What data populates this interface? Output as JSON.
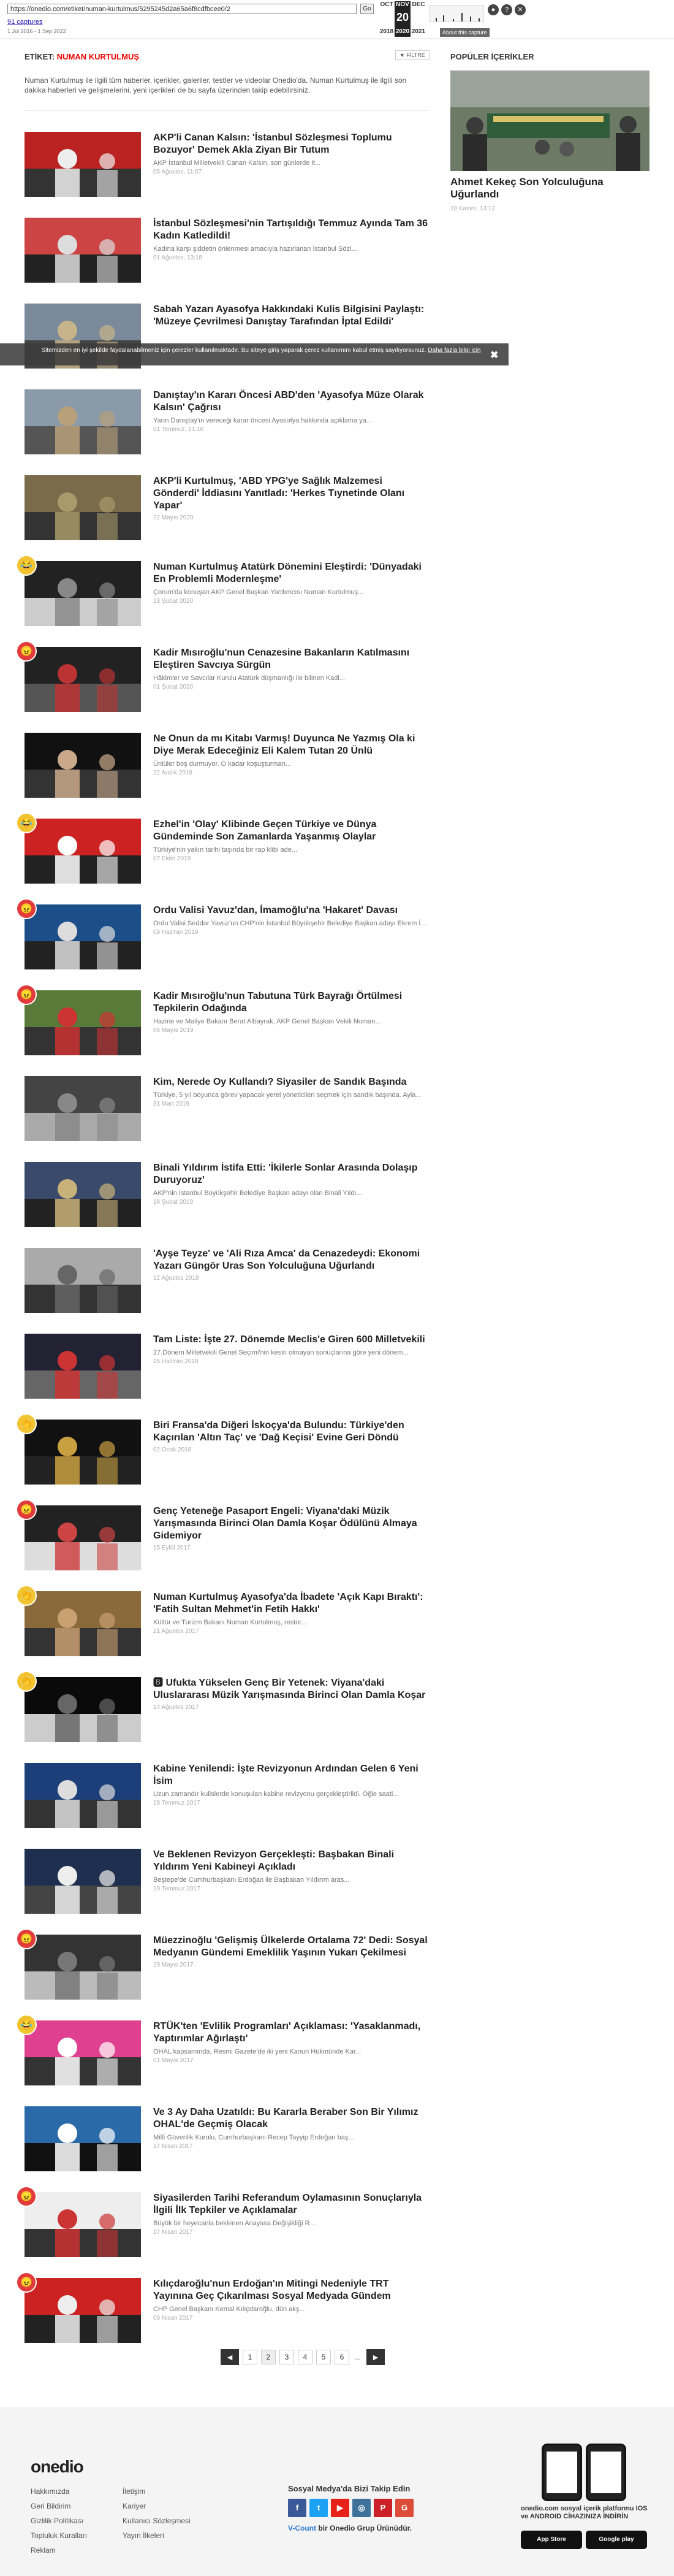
{
  "wayback": {
    "url": "https://onedio.com/etiket/numan-kurtulmus/5295245d2a65a6f8cdfbcee0/2",
    "go_label": "Go",
    "captures_label": "91 captures",
    "capture_range": "1 Jul 2016 - 1 Sep 2022",
    "months": [
      "OCT",
      "NOV",
      "DEC"
    ],
    "day": "20",
    "years": [
      "2018",
      "2020",
      "2021"
    ],
    "about_label": "About this capture"
  },
  "tag": {
    "prefix": "ETİKET:",
    "name": "NUMAN KURTULMUŞ",
    "filter_label": "▼ FİLTRE",
    "intro": "Numan Kurtulmuş ile ilgili tüm haberler, içerikler, galeriler, testler ve videolar Onedio'da. Numan Kurtulmuş ile ilgili son dakika haberleri ve gelişmelerini, yeni içerikleri de bu sayfa üzerinden takip edebilirsiniz."
  },
  "cookie": {
    "text": "Sitemizden en iyi şekilde faydalanabilmeniz için çerezler kullanılmaktadır. Bu siteye giriş yaparak çerez kullanımını kabul etmiş sayılıyorsunuz.",
    "link": "Daha fazla bilgi için",
    "close": "✖"
  },
  "items": [
    {
      "title": "AKP'li Canan Kalsın: 'İstanbul Sözleşmesi Toplumu Bozuyor' Demek Akla Ziyan Bir Tutum",
      "desc": "AKP İstanbul Milletvekili Canan Kalsın, son günlerde it...",
      "date": "05 Ağustos, 11:07",
      "badge": ""
    },
    {
      "title": "İstanbul Sözleşmesi'nin Tartışıldığı Temmuz Ayında Tam 36 Kadın Katledildi!",
      "desc": "Kadına karşı şiddetin önlenmesi amacıyla hazırlanan İstanbul Sözl...",
      "date": "01 Ağustos, 13:18",
      "badge": ""
    },
    {
      "title": "Sabah Yazarı Ayasofya Hakkındaki Kulis Bilgisini Paylaştı: 'Müzeye Çevrilmesi Danıştay Tarafından İptal Edildi'",
      "desc": "",
      "date": "",
      "badge": ""
    },
    {
      "title": "Danıştay'ın Kararı Öncesi ABD'den 'Ayasofya Müze Olarak Kalsın' Çağrısı",
      "desc": "Yarın Danıştay'ın vereceği karar öncesi Ayasofya hakkında açıklama ya...",
      "date": "01 Temmuz, 21:16",
      "badge": ""
    },
    {
      "title": "AKP'li Kurtulmuş, 'ABD YPG'ye Sağlık Malzemesi Gönderdi' İddiasını Yanıtladı: 'Herkes Tıynetinde Olanı Yapar'",
      "desc": "",
      "date": "22 Mayıs 2020",
      "badge": ""
    },
    {
      "title": "Numan Kurtulmuş Atatürk Dönemini Eleştirdi: 'Dünyadaki En Problemli Modernleşme'",
      "desc": "Çorum'da konuşan AKP Genel Başkan Yardımcısı Numan Kurtulmuş...",
      "date": "13 Şubat 2020",
      "badge": "laugh"
    },
    {
      "title": "Kadir Mısıroğlu'nun Cenazesine Bakanların Katılmasını Eleştiren Savcıya Sürgün",
      "desc": "Hâkimler ve Savcılar Kurulu Atatürk düşmanlığı ile bilinen Kadi...",
      "date": "01 Şubat 2020",
      "badge": "angry"
    },
    {
      "title": "Ne Onun da mı Kitabı Varmış! Duyunca Ne Yazmış Ola ki Diye Merak Edeceğiniz Eli Kalem Tutan 20 Ünlü",
      "desc": "Ünlüler boş durmuyor. O kadar koşuşturman...",
      "date": "22 Aralık 2019",
      "badge": ""
    },
    {
      "title": "Ezhel'in 'Olay' Klibinde Geçen Türkiye ve Dünya Gündeminde Son Zamanlarda Yaşanmış Olaylar",
      "desc": "Türkiye'nin yakın tarihi taşında bir rap klibi ade...",
      "date": "07 Ekim 2019",
      "badge": "laugh"
    },
    {
      "title": "Ordu Valisi Yavuz'dan, İmamoğlu'na 'Hakaret' Davası",
      "desc": "Ordu Valisi Seddar Yavuz'un CHP'nin İstanbul Büyükşehir Belediye Başkan adayı Ekrem İmamo...",
      "date": "09 Haziran 2019",
      "badge": "angry"
    },
    {
      "title": "Kadir Mısıroğlu'nun Tabutuna Türk Bayrağı Örtülmesi Tepkilerin Odağında",
      "desc": "Hazine ve Maliye Bakanı Berat Albayrak, AKP Genel Başkan Vekili Numan...",
      "date": "06 Mayıs 2019",
      "badge": "angry"
    },
    {
      "title": "Kim, Nerede Oy Kullandı? Siyasiler de Sandık Başında",
      "desc": "Türkiye, 5 yıl boyunca görev yapacak yerel yöneticileri seçmek için sandık başında. Ayla...",
      "date": "31 Mart 2019",
      "badge": ""
    },
    {
      "title": "Binali Yıldırım İstifa Etti: 'İkilerle Sonlar Arasında Dolaşıp Duruyoruz'",
      "desc": "AKP'nin İstanbul Büyükşehir Belediye Başkan adayı olan Binali Yıldı...",
      "date": "18 Şubat 2019",
      "badge": ""
    },
    {
      "title": "'Ayşe Teyze' ve 'Ali Rıza Amca' da Cenazedeydi: Ekonomi Yazarı Güngör Uras Son Yolculuğuna Uğurlandı",
      "desc": "",
      "date": "12 Ağustos 2018",
      "badge": ""
    },
    {
      "title": "Tam Liste: İşte 27. Dönemde Meclis'e Giren 600 Milletvekili",
      "desc": "27.Dönem Milletvekili Genel Seçimi'nin kesin olmayan sonuçlarına göre yeni dönem...",
      "date": "25 Haziran 2018",
      "badge": ""
    },
    {
      "title": "Biri Fransa'da Diğeri İskoçya'da Bulundu: Türkiye'den Kaçırılan 'Altın Taç' ve 'Dağ Keçisi' Evine Geri Döndü",
      "desc": "",
      "date": "02 Ocak 2018",
      "badge": "clap"
    },
    {
      "title": "Genç Yeteneğe Pasaport Engeli: Viyana'daki Müzik Yarışmasında Birinci Olan Damla Koşar Ödülünü Almaya Gidemiyor",
      "desc": "",
      "date": "15 Eylül 2017",
      "badge": "angry"
    },
    {
      "title": "Numan Kurtulmuş Ayasofya'da İbadete 'Açık Kapı Bıraktı': 'Fatih Sultan Mehmet'in Fetih Hakkı'",
      "desc": "Kültür ve Turizm Bakanı Numan Kurtulmuş, restor...",
      "date": "21 Ağustos 2017",
      "badge": "clap"
    },
    {
      "title": "🅱 Ufukta Yükselen Genç Bir Yetenek: Viyana'daki Uluslararası Müzik Yarışmasında Birinci Olan Damla Koşar",
      "desc": "",
      "date": "14 Ağustos 2017",
      "badge": "clap"
    },
    {
      "title": "Kabine Yenilendi: İşte Revizyonun Ardından Gelen 6 Yeni İsim",
      "desc": "Uzun zamandır kulislerde konuşulan kabine revizyonu gerçekleştirildi. Öğle saati...",
      "date": "19 Temmuz 2017",
      "badge": ""
    },
    {
      "title": "Ve Beklenen Revizyon Gerçekleşti: Başbakan Binali Yıldırım Yeni Kabineyi Açıkladı",
      "desc": "Beştepe'de Cumhurbaşkanı Erdoğan ile Başbakan Yıldırım aras...",
      "date": "19 Temmuz 2017",
      "badge": ""
    },
    {
      "title": "Müezzinoğlu 'Gelişmiş Ülkelerde Ortalama 72' Dedi: Sosyal Medyanın Gündemi Emeklilik Yaşının Yukarı Çekilmesi",
      "desc": "",
      "date": "29 Mayıs 2017",
      "badge": "angry"
    },
    {
      "title": "RTÜK'ten 'Evlilik Programları' Açıklaması: 'Yasaklanmadı, Yaptırımlar Ağırlaştı'",
      "desc": "OHAL kapsamında, Resmi Gazete'de iki yeni Kanun Hükmünde Kar...",
      "date": "01 Mayıs 2017",
      "badge": "laugh"
    },
    {
      "title": "Ve 3 Ay Daha Uzatıldı: Bu Kararla Beraber Son Bir Yılımız OHAL'de Geçmiş Olacak",
      "desc": "Millî Güvenlik Kurulu, Cumhurbaşkanı Recep Tayyip Erdoğan baş...",
      "date": "17 Nisan 2017",
      "badge": ""
    },
    {
      "title": "Siyasilerden Tarihi Referandum Oylamasının Sonuçlarıyla İlgili İlk Tepkiler ve Açıklamalar",
      "desc": "Büyük bir heyecanla beklenen Anayasa Değişikliği R...",
      "date": "17 Nisan 2017",
      "badge": "angry"
    },
    {
      "title": "Kılıçdaroğlu'nun Erdoğan'ın Mitingi Nedeniyle TRT Yayınına Geç Çıkarılması Sosyal Medyada Gündem",
      "desc": "CHP Genel Başkanı Kemal Kılıçdaroğlu, dün akş...",
      "date": "09 Nisan 2017",
      "badge": "angry"
    }
  ],
  "pager": {
    "prev": "◄",
    "pages": [
      "1",
      "2",
      "3",
      "4",
      "5",
      "6"
    ],
    "current": "2",
    "dots": "...",
    "next": "►"
  },
  "sidebar": {
    "heading": "POPÜLER İÇERİKLER",
    "title": "Ahmet Kekeç Son Yolculuğuna Uğurlandı",
    "date": "10 Kasım, 13:12"
  },
  "footer": {
    "logo": "onedio",
    "col1": [
      "Hakkımızda",
      "Geri Bildirim",
      "Gizlilik Politikası",
      "Topluluk Kuralları",
      "Reklam"
    ],
    "col2": [
      "İletişim",
      "Kariyer",
      "Kullanıcı Sözleşmesi",
      "Yayın İlkeleri"
    ],
    "social_heading": "Sosyal Medya'da Bizi Takip Edin",
    "social": [
      {
        "label": "f",
        "color": "#3b5998"
      },
      {
        "label": "t",
        "color": "#1da1f2"
      },
      {
        "label": "▶",
        "color": "#e62117"
      },
      {
        "label": "◎",
        "color": "#3f729b"
      },
      {
        "label": "P",
        "color": "#cb2027"
      },
      {
        "label": "G",
        "color": "#dd4b39"
      }
    ],
    "vcount_pre": "V-Count",
    "vcount_post": " bir Onedio Grup Ürünüdür.",
    "app_text": "onedio.com sosyal içerik platformu IOS ve ANDROID CİHAZINIZA İNDİRİN",
    "appstore": "App Store",
    "googleplay": "Google play"
  }
}
